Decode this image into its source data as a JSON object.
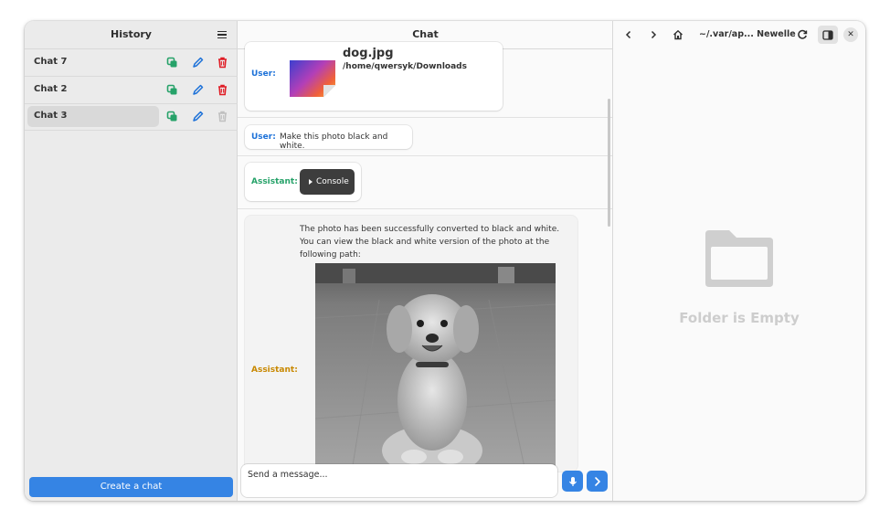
{
  "sidebar": {
    "title": "History",
    "chats": [
      {
        "label": "Chat 7"
      },
      {
        "label": "Chat 2"
      },
      {
        "label": "Chat 3"
      }
    ],
    "create_label": "Create a chat"
  },
  "chat": {
    "title": "Chat",
    "messages": [
      {
        "role": "User:",
        "file_name": "dog.jpg",
        "file_path": "/home/qwersyk/Downloads"
      },
      {
        "role": "User:",
        "text": "Make this photo black and white."
      },
      {
        "role": "Assistant:",
        "button": "Console"
      },
      {
        "role": "Assistant:",
        "text": "The photo has been successfully converted to black and white. You can view the black and white version of the photo at the following path:"
      }
    ],
    "input_placeholder": "Send a message..."
  },
  "files": {
    "path": "~/.var/ap... Newelle",
    "empty_text": "Folder is Empty"
  },
  "colors": {
    "accent": "#3584e4",
    "user": "#1c71d8",
    "assistant": "#26a269",
    "assistant_alt": "#c88800",
    "copy": "#26a269",
    "edit": "#1c71d8",
    "delete": "#e01b24"
  },
  "icons": [
    "menu-icon",
    "copy-icon",
    "edit-icon",
    "trash-icon",
    "mic-icon",
    "send-icon",
    "back-icon",
    "forward-icon",
    "home-icon",
    "reload-icon",
    "sidebar-toggle-icon",
    "close-icon",
    "folder-icon"
  ]
}
